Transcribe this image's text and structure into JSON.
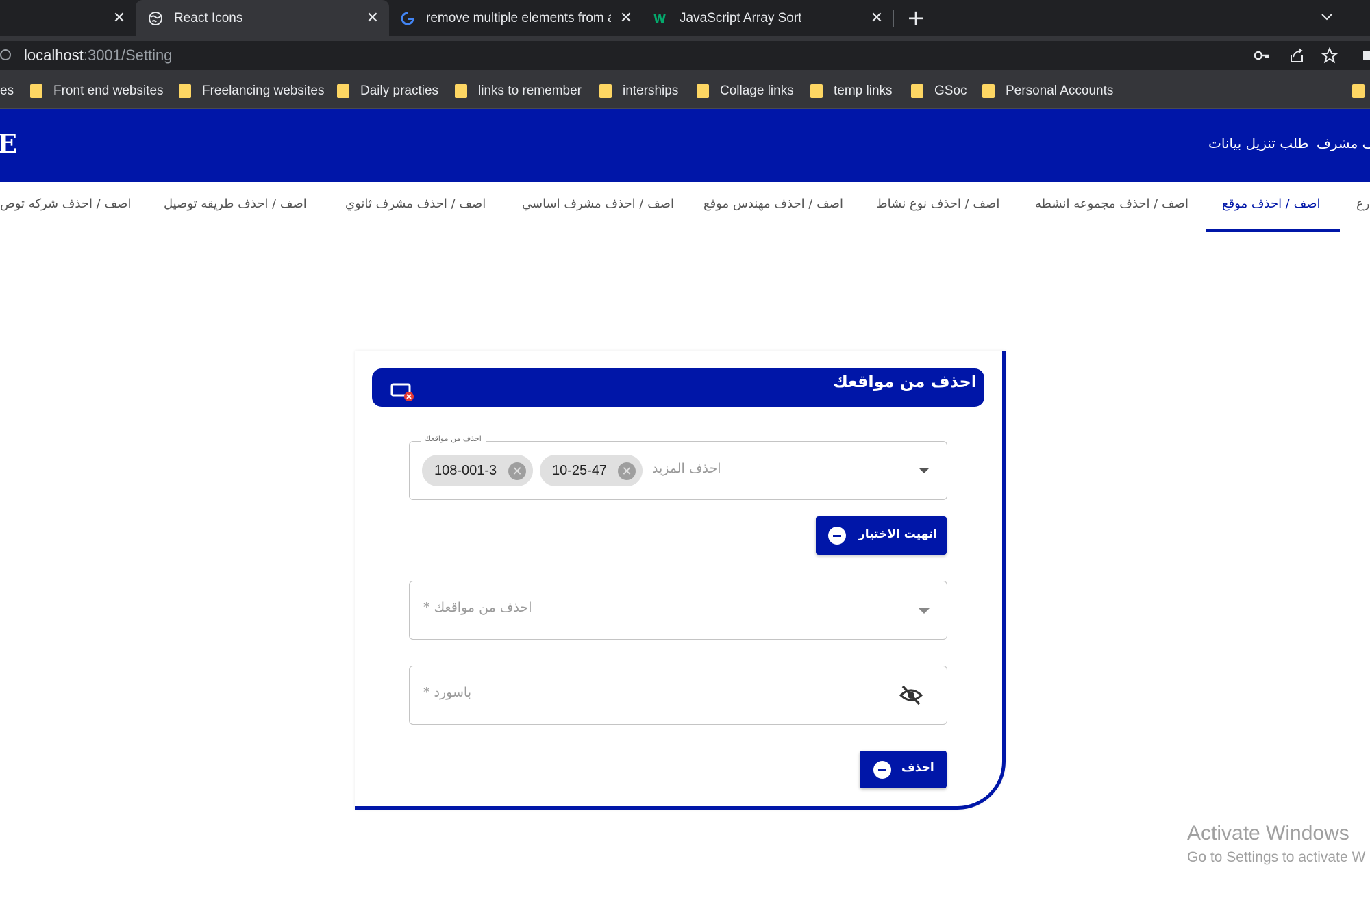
{
  "browser": {
    "tabs": [
      {
        "title": "",
        "active": false
      },
      {
        "title": "React Icons",
        "active": true,
        "icon": "globe-icon"
      },
      {
        "title": "remove multiple elements from a",
        "active": false,
        "icon": "google-icon"
      },
      {
        "title": "JavaScript Array Sort",
        "active": false,
        "icon": "w3schools-icon"
      }
    ],
    "new_tab": "+",
    "url_host": "localhost",
    "url_rest": ":3001/Setting",
    "bookmarks": [
      "es",
      "Front end websites",
      "Freelancing websites",
      "Daily practies",
      "links to remember",
      "interships",
      "Collage links",
      "temp links",
      "GSoc",
      "Personal Accounts"
    ]
  },
  "app": {
    "brand": "E",
    "header_links": [
      "طلب تنزيل بيانات",
      "ف مشرف"
    ],
    "accent": "#0016a8",
    "settings_tabs": [
      "اصف / احذف موقع",
      "اصف / احذف مجموعه انشطه",
      "اصف / احذف نوع نشاط",
      "اصف / احذف مهندس موقع",
      "اصف / احذف مشرف اساسي",
      "اصف / احذف مشرف ثانوي",
      "اصف / احذف طريقه توصيل",
      "اصف / احذف شركه توص",
      "رع"
    ]
  },
  "card": {
    "title": "احذف من مواقعك",
    "select1": {
      "legend": "احذف من مواقعك",
      "chips": [
        "108-001-3",
        "10-25-47"
      ],
      "placeholder": "احذف المزيد"
    },
    "finish_button": "انهيت الاختيار",
    "select2": {
      "placeholder": "احذف من مواقعك *"
    },
    "password": {
      "placeholder": "باسورد *"
    },
    "delete_button": "احذف"
  },
  "watermark": {
    "line1": "Activate Windows",
    "line2": "Go to Settings to activate W"
  }
}
